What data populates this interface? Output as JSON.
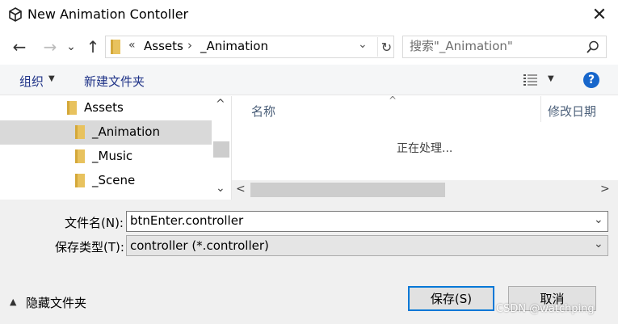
{
  "window": {
    "title": "New Animation Contoller",
    "close_glyph": "✕"
  },
  "nav": {
    "back_glyph": "←",
    "forward_glyph": "→",
    "dropdown_glyph": "⌄",
    "up_glyph": "↑"
  },
  "address": {
    "chevrons": "«",
    "segments": [
      "Assets",
      "_Animation"
    ],
    "separator": "›",
    "dropdown_glyph": "⌄",
    "refresh_glyph": "↻"
  },
  "search": {
    "placeholder": "搜索\"_Animation\""
  },
  "toolbar": {
    "organize_label": "组织",
    "organize_caret": "▼",
    "new_folder_label": "新建文件夹",
    "view_caret": "▼",
    "help_glyph": "?"
  },
  "tree": {
    "items": [
      {
        "label": "Assets"
      },
      {
        "label": "_Animation"
      },
      {
        "label": "_Music"
      },
      {
        "label": "_Scene"
      }
    ],
    "scroll_up": "^",
    "scroll_down": "⌄"
  },
  "list": {
    "columns": [
      "名称",
      "修改日期"
    ],
    "sort_glyph": "^",
    "status_text": "正在处理...",
    "scroll_left": "<",
    "scroll_right": ">"
  },
  "form": {
    "filename_label": "文件名(N):",
    "filename_value": "btnEnter.controller",
    "type_label": "保存类型(T):",
    "type_value": "controller (*.controller)",
    "caret": "⌄"
  },
  "footer": {
    "hide_caret": "▲",
    "hide_folders_label": "隐藏文件夹",
    "save_label": "保存(S)",
    "cancel_label": "取消",
    "watermark": "CSDN @watchping"
  },
  "colors": {
    "accent": "#0078d7",
    "help": "#1766cb",
    "folder": "#e8c25e"
  },
  "icons": [
    "unity-logo-icon",
    "close-icon",
    "back-arrow-icon",
    "forward-arrow-icon",
    "recent-dropdown-icon",
    "up-arrow-icon",
    "folder-icon",
    "refresh-icon",
    "search-icon",
    "view-options-icon",
    "help-icon"
  ]
}
